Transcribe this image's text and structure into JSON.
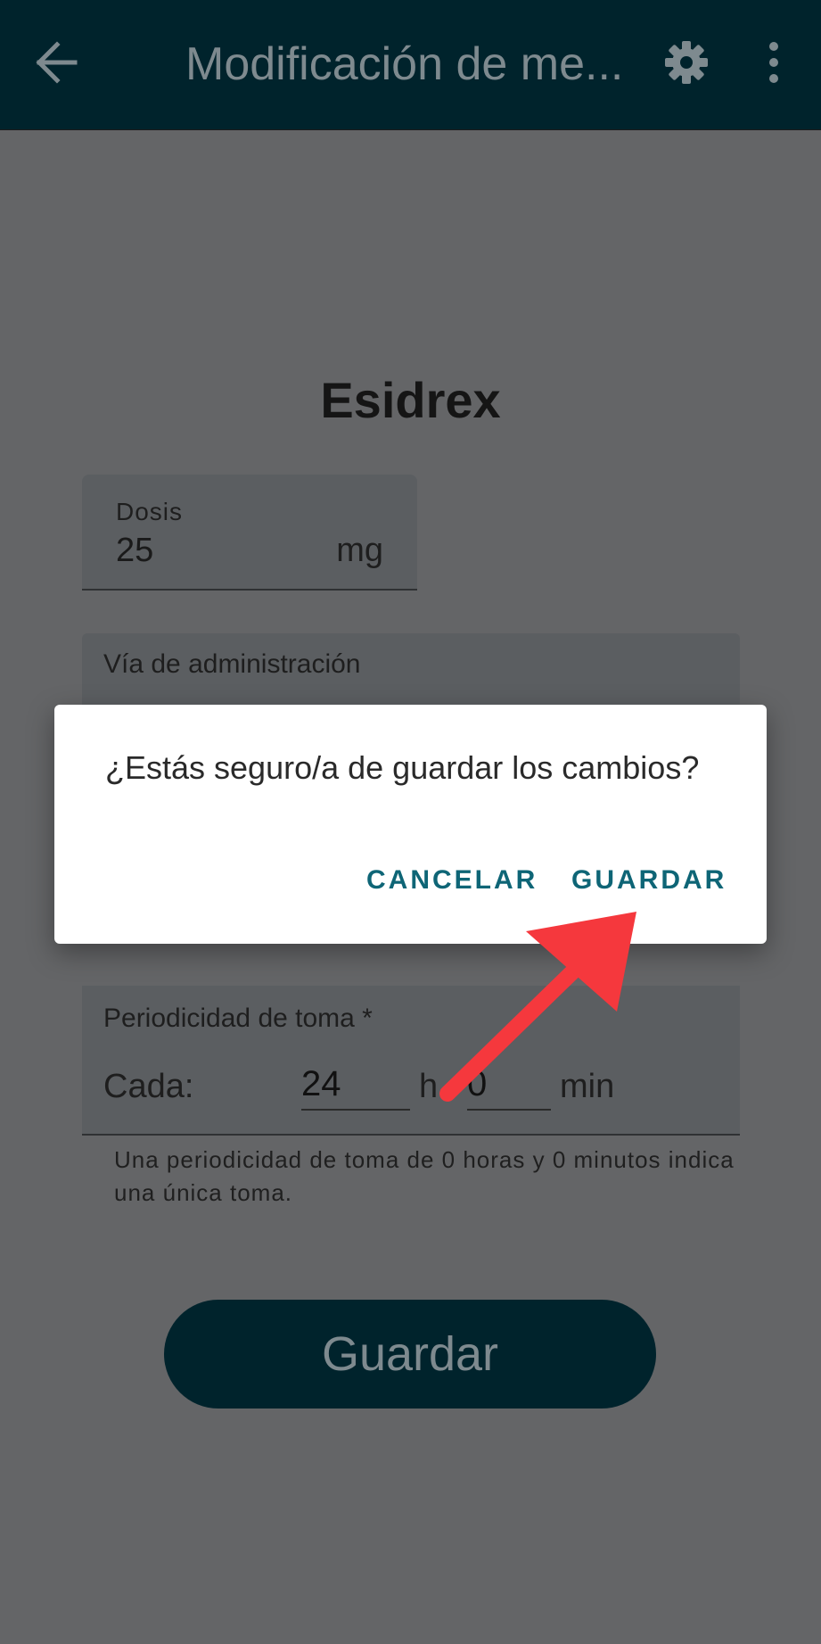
{
  "app_bar": {
    "title": "Modificación de me...",
    "back_icon": "arrow-left-icon",
    "settings_icon": "gear-icon",
    "more_icon": "more-vert-icon",
    "background": "#00232c"
  },
  "form": {
    "medication_name": "Esidrex",
    "dose": {
      "label": "Dosis",
      "value": "25",
      "unit": "mg"
    },
    "route": {
      "label": "Vía de administración"
    },
    "period": {
      "label": "Periodicidad de toma *",
      "every_label": "Cada:",
      "hours_value": "24",
      "hours_unit": "h",
      "minutes_value": "0",
      "minutes_unit": "min",
      "helper": "Una periodicidad de toma de 0 horas y 0 minutos indica una única toma."
    },
    "save_button": "Guardar"
  },
  "dialog": {
    "message": "¿Estás seguro/a de guardar los cambios?",
    "cancel_label": "CANCELAR",
    "confirm_label": "GUARDAR",
    "accent": "#0e6576"
  },
  "annotation": {
    "arrow_color": "#f5383d"
  }
}
